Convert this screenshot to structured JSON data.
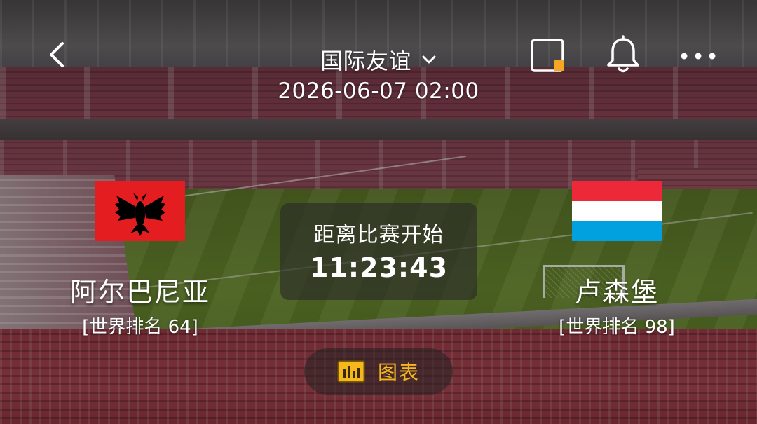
{
  "header": {
    "back_icon": "chevron-left-icon",
    "title": "国际友谊",
    "title_dropdown_icon": "chevron-down-icon",
    "datetime": "2026-06-07 02:00",
    "pip_icon": "picture-in-picture-icon",
    "pip_accent_color": "#f5a623",
    "bell_icon": "bell-icon",
    "more_icon": "more-horizontal-icon"
  },
  "home_team": {
    "name": "阿尔巴尼亚",
    "rank": "[世界排名 64]",
    "flag_icon": "albania-flag",
    "flag_colors": [
      "#e41e20",
      "#000000"
    ]
  },
  "away_team": {
    "name": "卢森堡",
    "rank": "[世界排名 98]",
    "flag_icon": "luxembourg-flag",
    "flag_colors": [
      "#ed2939",
      "#ffffff",
      "#00a1de"
    ]
  },
  "countdown": {
    "label": "距离比赛开始",
    "value": "11:23:43"
  },
  "chart_button": {
    "label": "图表",
    "icon": "bar-chart-icon",
    "color": "#f5b81c"
  }
}
